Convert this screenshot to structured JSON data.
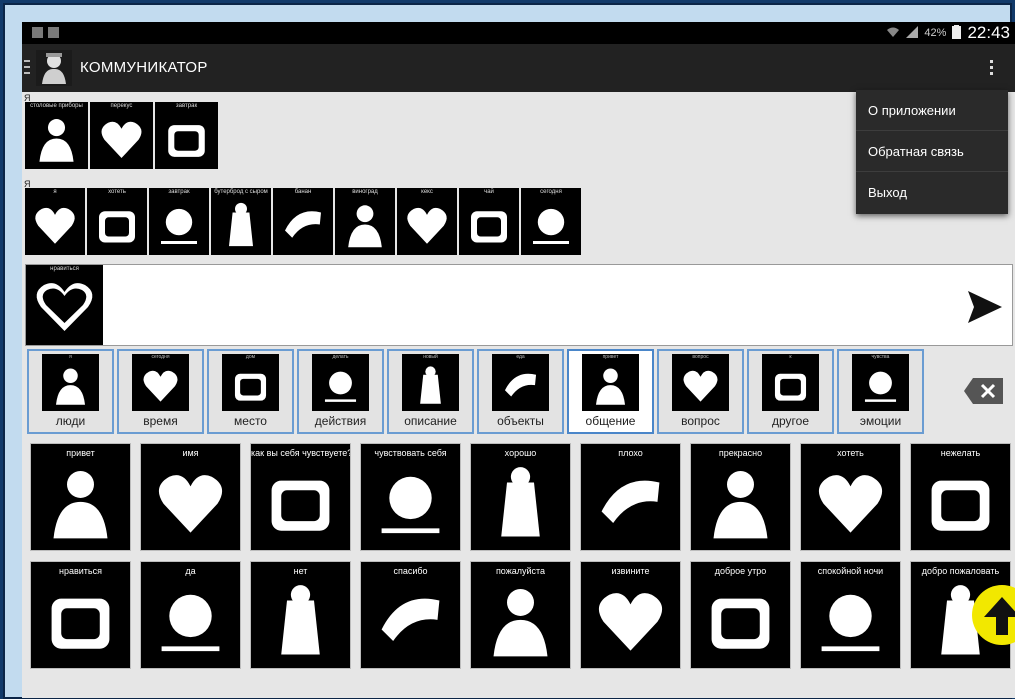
{
  "status_bar": {
    "battery": "42%",
    "time": "22:43"
  },
  "app": {
    "title": "КОММУНИКАТОР"
  },
  "menu": {
    "items": [
      "О приложении",
      "Обратная связь",
      "Выход"
    ]
  },
  "phrase_rows": [
    {
      "label": "Я",
      "cards": [
        "столовые приборы",
        "перекус",
        "завтрак"
      ]
    },
    {
      "label": "Я",
      "cards": [
        "я",
        "хотеть",
        "завтрак",
        "бутерброд с сыром",
        "банан",
        "виноград",
        "кекс",
        "чай",
        "сегодня"
      ]
    }
  ],
  "sentence": {
    "cards": [
      "нравиться"
    ],
    "send_icon": "send-icon"
  },
  "categories": [
    {
      "name": "люди",
      "tag": "я"
    },
    {
      "name": "время",
      "tag": "сегодня"
    },
    {
      "name": "место",
      "tag": "дом"
    },
    {
      "name": "действия",
      "tag": "делать"
    },
    {
      "name": "описание",
      "tag": "новый"
    },
    {
      "name": "объекты",
      "tag": "еда"
    },
    {
      "name": "общение",
      "tag": "привет",
      "active": true
    },
    {
      "name": "вопрос",
      "tag": "вопрос"
    },
    {
      "name": "другое",
      "tag": "к"
    },
    {
      "name": "эмоции",
      "tag": "чувства"
    }
  ],
  "grid_rows": [
    [
      "привет",
      "имя",
      "как вы себя чувствуете?",
      "чувствовать себя",
      "хорошо",
      "плохо",
      "прекрасно",
      "хотеть",
      "нежелать"
    ],
    [
      "нравиться",
      "да",
      "нет",
      "спасибо",
      "пожалуйста",
      "извините",
      "доброе утро",
      "спокойной ночи",
      "добро пожаловать"
    ]
  ],
  "colors": {
    "category_border": "#6a9cd2",
    "fab": "#f2e800",
    "app_bar": "#222222",
    "frame": "#123a6a"
  }
}
